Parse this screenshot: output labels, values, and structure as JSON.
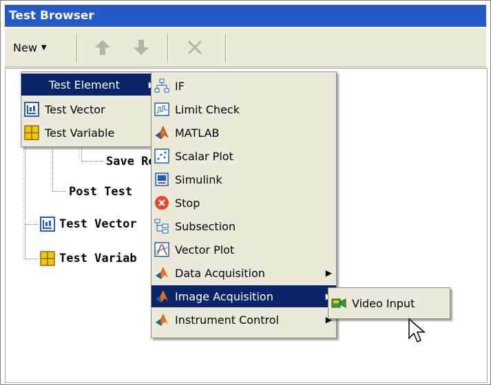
{
  "window": {
    "title": "Test Browser"
  },
  "toolbar": {
    "new_label": "New"
  },
  "tree": {
    "items": [
      {
        "label": "Save Re"
      },
      {
        "label": "Post Test"
      },
      {
        "label": "Test Vector"
      },
      {
        "label": "Test Variab"
      }
    ]
  },
  "menu_new": {
    "items": [
      {
        "label": "Test Element",
        "icon": "none",
        "submenu": true
      },
      {
        "label": "Test Vector",
        "icon": "test-vector-icon"
      },
      {
        "label": "Test Variable",
        "icon": "test-variable-icon"
      }
    ]
  },
  "menu_elements": {
    "items": [
      {
        "label": "IF",
        "icon": "if-icon"
      },
      {
        "label": "Limit Check",
        "icon": "limit-check-icon"
      },
      {
        "label": "MATLAB",
        "icon": "matlab-icon"
      },
      {
        "label": "Scalar Plot",
        "icon": "scalar-plot-icon"
      },
      {
        "label": "Simulink",
        "icon": "simulink-icon"
      },
      {
        "label": "Stop",
        "icon": "stop-icon"
      },
      {
        "label": "Subsection",
        "icon": "subsection-icon"
      },
      {
        "label": "Vector Plot",
        "icon": "vector-plot-icon"
      },
      {
        "label": "Data Acquisition",
        "icon": "data-acquisition-icon",
        "submenu": true
      },
      {
        "label": "Image Acquisition",
        "icon": "image-acquisition-icon",
        "submenu": true
      },
      {
        "label": "Instrument Control",
        "icon": "instrument-control-icon",
        "submenu": true
      }
    ]
  },
  "menu_image_acq": {
    "items": [
      {
        "label": "Video Input",
        "icon": "video-input-icon"
      }
    ]
  },
  "colors": {
    "title_bar": "#2459c7",
    "highlight": "#0a246a",
    "menu_bg": "#ece9d8"
  }
}
